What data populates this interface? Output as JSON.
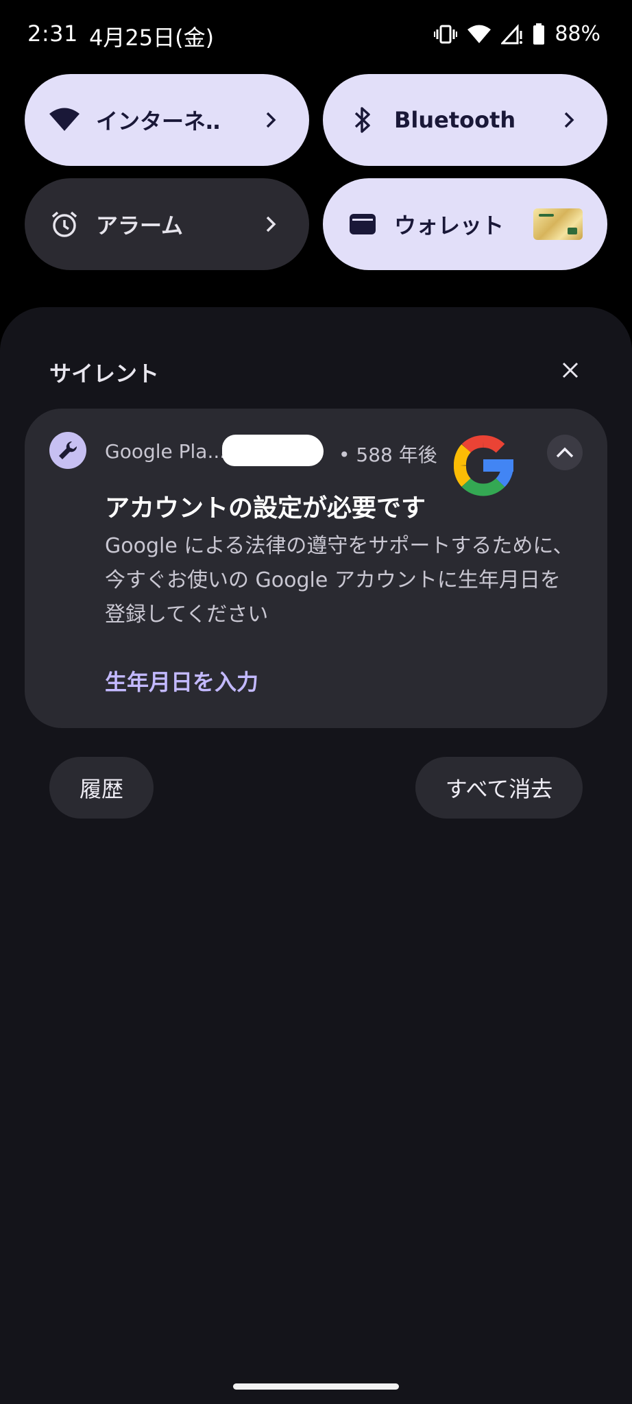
{
  "status_bar": {
    "time": "2:31",
    "date": "4月25日(金)",
    "battery": "88%"
  },
  "quick_tiles": [
    {
      "label": "インターネ‥",
      "icon": "wifi-icon",
      "state": "on"
    },
    {
      "label": "Bluetooth",
      "icon": "bluetooth-icon",
      "state": "on"
    },
    {
      "label": "アラーム",
      "icon": "alarm-icon",
      "state": "off"
    },
    {
      "label": "ウォレット",
      "icon": "wallet-icon",
      "state": "on"
    }
  ],
  "notifications": {
    "section_title": "サイレント",
    "card": {
      "app_name": "Google Pla...",
      "time": "• 588 年後",
      "title": "アカウントの設定が必要です",
      "body": "Google による法律の遵守をサポートするために、今すぐお使いの Google アカウントに生年月日を登録してください",
      "action": "生年月日を入力"
    },
    "history_label": "履歴",
    "clear_all_label": "すべて消去"
  },
  "colors": {
    "tile_on": "#e2dff9",
    "tile_off": "#2b2a31",
    "shade_bg": "#14141a",
    "card_bg": "#2a2a31",
    "accent": "#c3b9ff"
  }
}
